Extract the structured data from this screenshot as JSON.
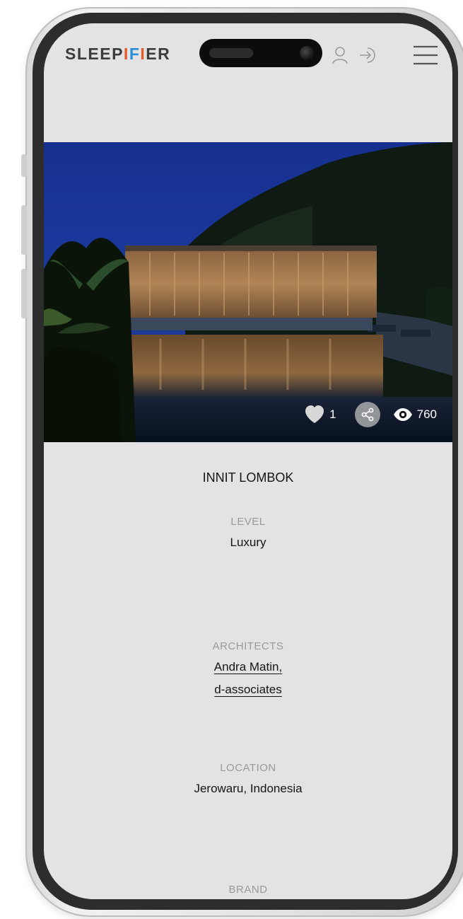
{
  "header": {
    "logo": {
      "part1": "SLEEP",
      "part2": "I",
      "part3": "F",
      "part4": "I",
      "part5": "ER"
    },
    "icons": [
      "user-icon",
      "login-icon",
      "menu-icon"
    ]
  },
  "hero": {
    "stats": {
      "likes": "1",
      "views": "760"
    },
    "icons": [
      "heart-icon",
      "share-icon",
      "eye-icon"
    ]
  },
  "hotel": {
    "name": "INNIT LOMBOK",
    "level": {
      "label": "LEVEL",
      "value": "Luxury"
    },
    "architects": {
      "label": "ARCHITECTS",
      "names": [
        "Andra Matin,",
        "d-associates"
      ]
    },
    "location": {
      "label": "LOCATION",
      "value": "Jerowaru, Indonesia"
    },
    "brand": {
      "label": "BRAND"
    }
  },
  "colors": {
    "screen_bg": "#e3e3e5",
    "logo_text": "#3c3c3c",
    "logo_accent_1": "#e35a2a",
    "logo_accent_2": "#2a8fd6",
    "label_text": "#9a9a9a",
    "value_text": "#151515"
  }
}
